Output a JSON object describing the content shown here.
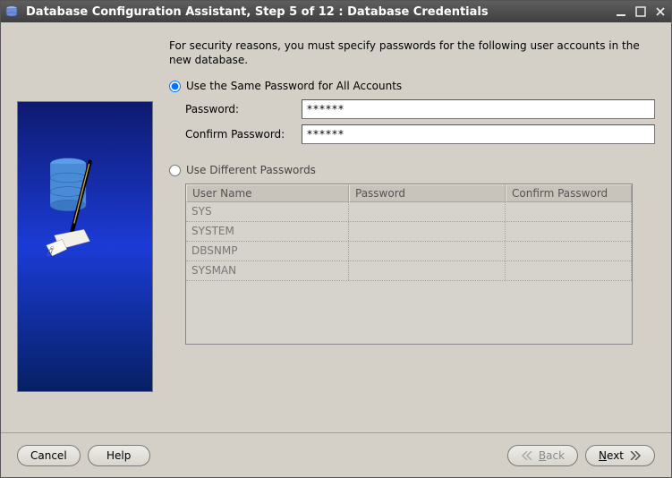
{
  "window": {
    "title": "Database Configuration Assistant, Step 5 of 12 : Database Credentials"
  },
  "intro": "For security reasons, you must specify passwords for the following user accounts in the new database.",
  "options": {
    "same": {
      "label": "Use the Same Password for All Accounts",
      "selected": true,
      "password_label": "Password:",
      "password_value": "******",
      "confirm_label": "Confirm Password:",
      "confirm_value": "******"
    },
    "diff": {
      "label": "Use Different Passwords",
      "selected": false,
      "columns": {
        "user": "User Name",
        "pw": "Password",
        "cpw": "Confirm Password"
      },
      "rows": [
        {
          "user": "SYS",
          "pw": "",
          "cpw": ""
        },
        {
          "user": "SYSTEM",
          "pw": "",
          "cpw": ""
        },
        {
          "user": "DBSNMP",
          "pw": "",
          "cpw": ""
        },
        {
          "user": "SYSMAN",
          "pw": "",
          "cpw": ""
        }
      ]
    }
  },
  "buttons": {
    "cancel": "Cancel",
    "help": "Help",
    "back_mnemonic": "B",
    "back_rest": "ack",
    "next_mnemonic": "N",
    "next_rest": "ext"
  }
}
